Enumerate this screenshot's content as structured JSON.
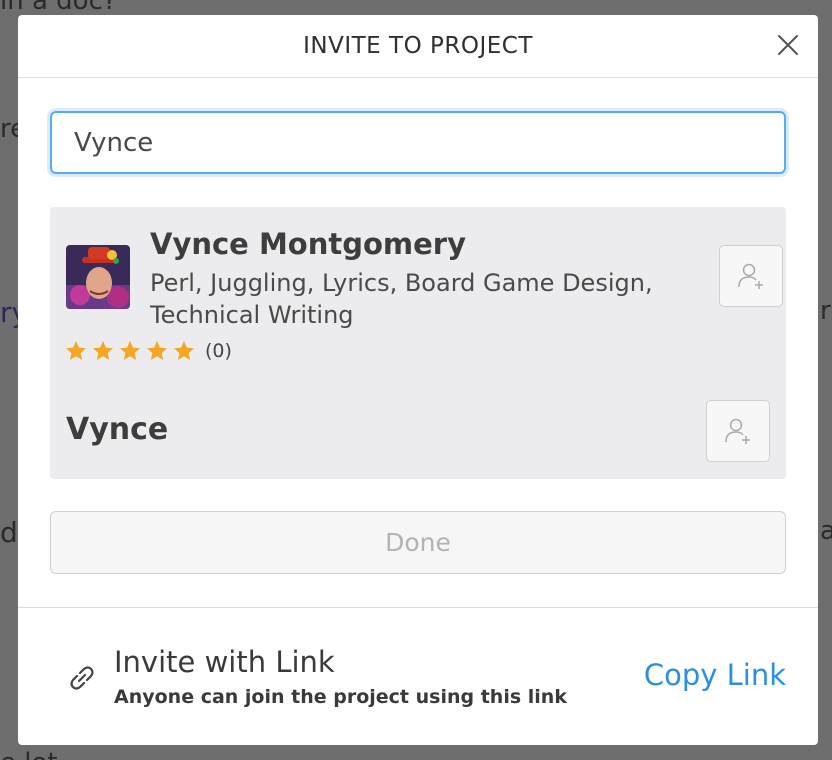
{
  "background": {
    "fragments": [
      "in a doc?",
      "re",
      "ry",
      "d",
      "e lot",
      "r?",
      "ay"
    ]
  },
  "modal": {
    "title": "INVITE TO PROJECT",
    "close_icon": "close-icon"
  },
  "search": {
    "value": "Vynce"
  },
  "results": [
    {
      "name": "Vynce Montgomery",
      "skills": "Perl, Juggling, Lyrics, Board Game Design, Technical Writing",
      "rating": {
        "stars": 5,
        "count_label": "(0)"
      },
      "add_icon": "add-user-icon"
    },
    {
      "name": "Vynce",
      "add_icon": "add-user-icon"
    }
  ],
  "done_label": "Done",
  "invite_link": {
    "icon": "link-icon",
    "title": "Invite with Link",
    "subtitle": "Anyone can join the project using this link",
    "copy_label": "Copy Link"
  },
  "colors": {
    "accent": "#2d8fe0",
    "focus_border": "#5aaaf0",
    "star": "#f5a623",
    "results_bg": "#ececee"
  }
}
